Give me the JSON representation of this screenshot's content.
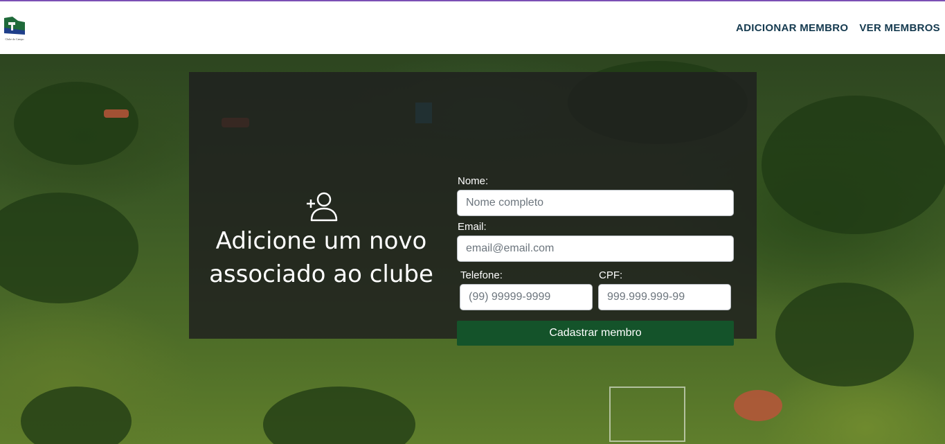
{
  "navbar": {
    "logo_caption": "Clube do Campo",
    "links": [
      {
        "label": "ADICIONAR MEMBRO"
      },
      {
        "label": "VER MEMBROS"
      }
    ]
  },
  "hero": {
    "icon": "person-add-icon",
    "title": "Adicione um novo associado ao clube"
  },
  "form": {
    "name_label": "Nome:",
    "name_placeholder": "Nome completo",
    "name_value": "",
    "email_label": "Email:",
    "email_placeholder": "email@email.com",
    "email_value": "",
    "phone_label": "Telefone:",
    "phone_placeholder": "(99) 99999-9999",
    "phone_value": "",
    "cpf_label": "CPF:",
    "cpf_placeholder": "999.999.999-99",
    "cpf_value": "",
    "submit_label": "Cadastrar membro"
  },
  "colors": {
    "accent_line": "#7b4fb5",
    "nav_text": "#153a4f",
    "submit_bg": "#14532a",
    "panel_bg": "rgba(30,30,30,0.82)"
  }
}
